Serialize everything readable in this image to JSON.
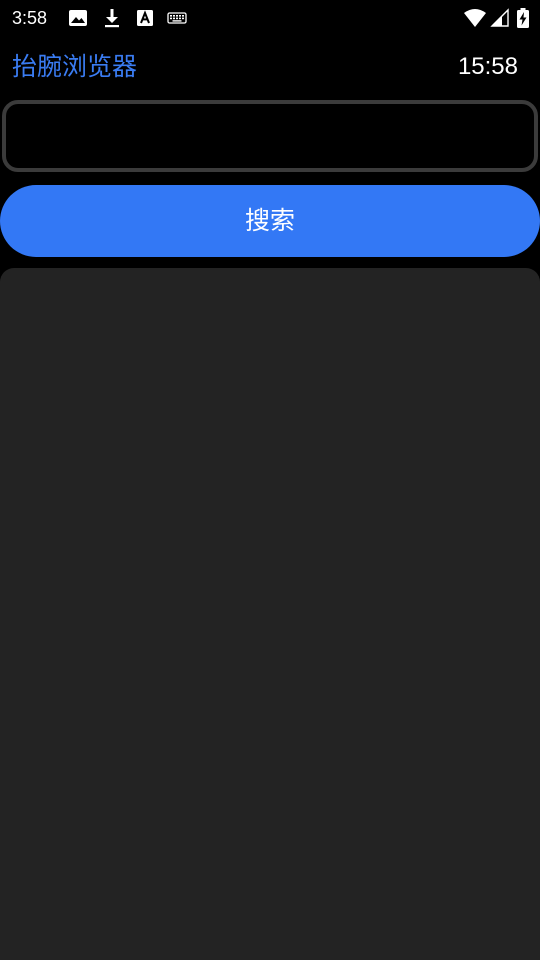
{
  "status_bar": {
    "time": "3:58",
    "icons_left": [
      "image-icon",
      "download-icon",
      "font-a-icon",
      "keyboard-icon"
    ],
    "icons_right": [
      "wifi-icon",
      "cell-signal-icon",
      "battery-charging-icon"
    ]
  },
  "header": {
    "title": "抬腕浏览器",
    "clock": "15:58"
  },
  "search": {
    "input_value": "",
    "placeholder": "",
    "button_label": "搜索"
  },
  "colors": {
    "accent": "#3378f5",
    "title": "#3a7cf2",
    "background": "#000000",
    "panel": "#232323",
    "input_border": "#3b3b3b"
  }
}
